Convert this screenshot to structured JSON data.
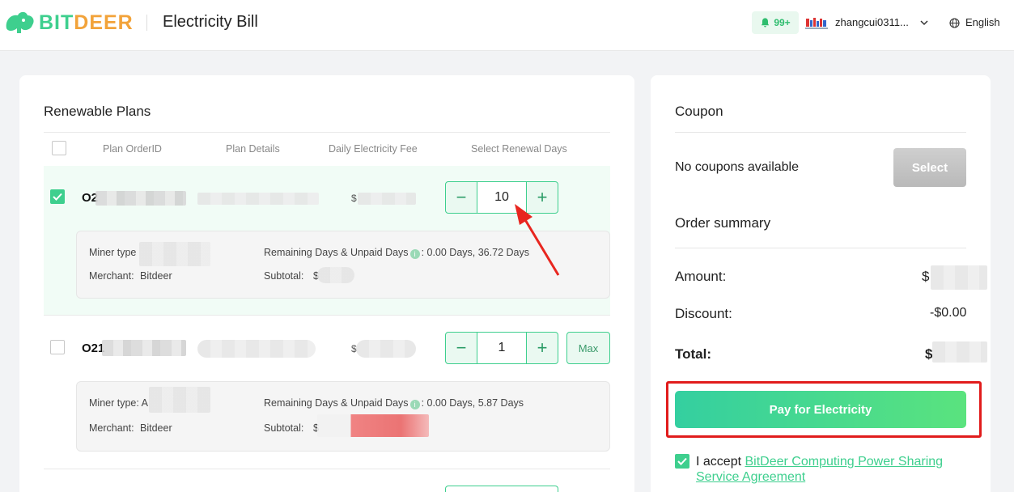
{
  "header": {
    "brand_bit": "BIT",
    "brand_deer": "DEER",
    "page_title": "Electricity Bill",
    "notification_count": "99+",
    "username": "zhangcui0311...",
    "language": "English",
    "colors": {
      "brand_green": "#3ecf8e",
      "brand_orange": "#f2a33a"
    }
  },
  "plans": {
    "title": "Renewable Plans",
    "columns": [
      "Plan OrderID",
      "Plan Details",
      "Daily Electricity Fee",
      "Select Renewal Days"
    ],
    "rows": [
      {
        "checked": true,
        "order_id_prefix": "O2",
        "fee_prefix": "$",
        "days": "10",
        "miner_type_label": "Miner type",
        "merchant_label": "Merchant:",
        "merchant": "Bitdeer",
        "remaining_label": "Remaining Days & Unpaid Days",
        "remaining_value": ": 0.00 Days, 36.72 Days",
        "subtotal_label": "Subtotal:",
        "subtotal_prefix": "$"
      },
      {
        "checked": false,
        "order_id_prefix": "O21",
        "fee_prefix": "$",
        "days": "1",
        "max_label": "Max",
        "miner_type_label": "Miner type: A",
        "merchant_label": "Merchant:",
        "merchant": "Bitdeer",
        "remaining_label": "Remaining Days & Unpaid Days",
        "remaining_value": ": 0.00 Days, 5.87 Days",
        "subtotal_label": "Subtotal:",
        "subtotal_prefix": "$"
      }
    ]
  },
  "summary": {
    "coupon_title": "Coupon",
    "coupon_status": "No coupons available",
    "select_label": "Select",
    "order_summary_title": "Order summary",
    "amount_label": "Amount:",
    "amount_prefix": "$",
    "discount_label": "Discount:",
    "discount_value": "-$0.00",
    "total_label": "Total:",
    "total_prefix": "$",
    "pay_label": "Pay for Electricity",
    "accept_text": "I accept",
    "agreement_link": "BitDeer Computing Power Sharing Service Agreement",
    "accept_checked": true
  },
  "icons": [
    "brand-deer-icon",
    "bell-icon",
    "chevron-down-icon",
    "globe-icon",
    "check-icon",
    "minus-icon",
    "plus-icon",
    "info-icon",
    "arrow-annotation-icon"
  ]
}
